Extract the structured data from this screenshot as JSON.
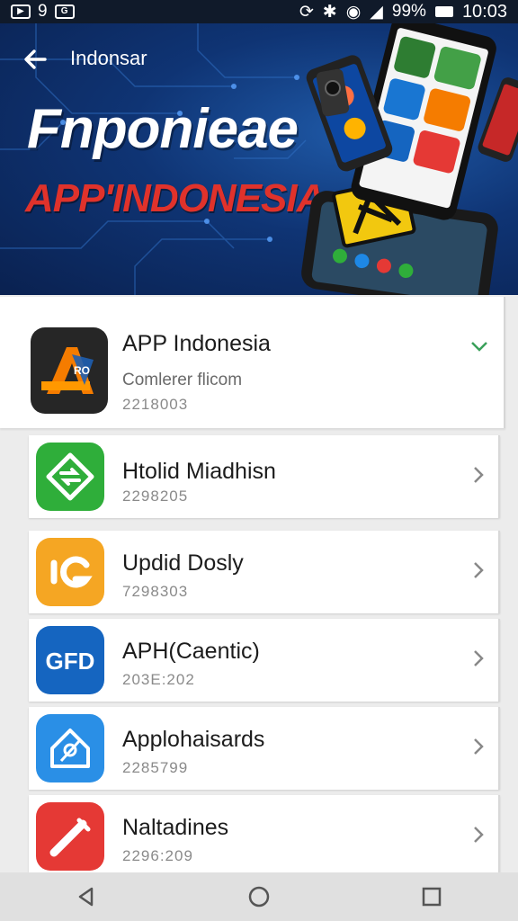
{
  "status_bar": {
    "left_glyph": "9",
    "time": "10:03",
    "battery": "99%"
  },
  "hero": {
    "title": "Indonsar",
    "headline": "Fnponieae",
    "subline": "APP'INDONESIA",
    "colors": {
      "background": "#0f3474",
      "subline": "#e0322b"
    }
  },
  "featured": {
    "name": "APP Indonesia",
    "subtitle": "Comlerer flicom",
    "code": "2218003"
  },
  "apps": [
    {
      "name": "Htolid Miadhisn",
      "code": "2298205",
      "icon": "green-arrow-icon",
      "color": "#2fae3a"
    },
    {
      "name": "Updid Dosly",
      "code": "7298303",
      "icon": "yellow-g-icon",
      "color": "#f5a623"
    },
    {
      "name": "APH(Caentic)",
      "code": "203E:202",
      "icon": "blue-gfd-icon",
      "color": "#1565c0"
    },
    {
      "name": "Applohaisards",
      "code": "2285799",
      "icon": "blue-house-icon",
      "color": "#2a8fe6"
    },
    {
      "name": "Naltadines",
      "code": "2296:209",
      "icon": "red-pen-icon",
      "color": "#e53935"
    }
  ],
  "nav": {
    "back": "back-triangle-icon",
    "home": "home-circle-icon",
    "recent": "recent-square-icon"
  }
}
